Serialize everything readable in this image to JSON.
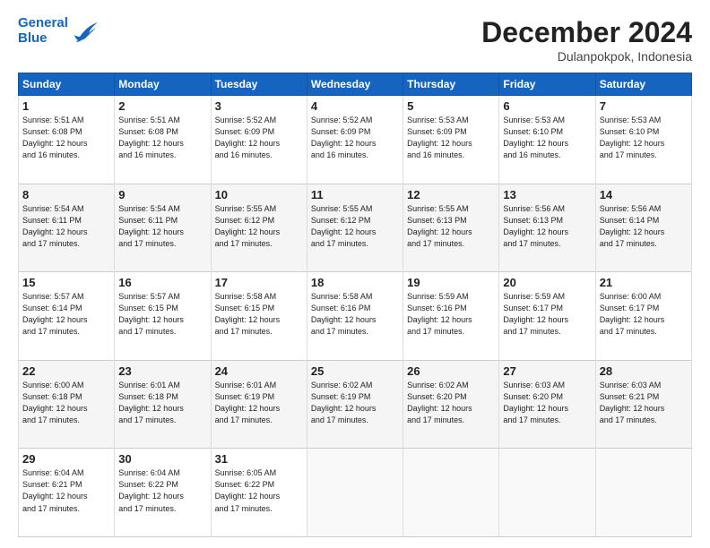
{
  "header": {
    "logo_line1": "General",
    "logo_line2": "Blue",
    "month_title": "December 2024",
    "location": "Dulanpokpok, Indonesia"
  },
  "weekdays": [
    "Sunday",
    "Monday",
    "Tuesday",
    "Wednesday",
    "Thursday",
    "Friday",
    "Saturday"
  ],
  "weeks": [
    [
      {
        "day": "1",
        "info": "Sunrise: 5:51 AM\nSunset: 6:08 PM\nDaylight: 12 hours\nand 16 minutes."
      },
      {
        "day": "2",
        "info": "Sunrise: 5:51 AM\nSunset: 6:08 PM\nDaylight: 12 hours\nand 16 minutes."
      },
      {
        "day": "3",
        "info": "Sunrise: 5:52 AM\nSunset: 6:09 PM\nDaylight: 12 hours\nand 16 minutes."
      },
      {
        "day": "4",
        "info": "Sunrise: 5:52 AM\nSunset: 6:09 PM\nDaylight: 12 hours\nand 16 minutes."
      },
      {
        "day": "5",
        "info": "Sunrise: 5:53 AM\nSunset: 6:09 PM\nDaylight: 12 hours\nand 16 minutes."
      },
      {
        "day": "6",
        "info": "Sunrise: 5:53 AM\nSunset: 6:10 PM\nDaylight: 12 hours\nand 16 minutes."
      },
      {
        "day": "7",
        "info": "Sunrise: 5:53 AM\nSunset: 6:10 PM\nDaylight: 12 hours\nand 17 minutes."
      }
    ],
    [
      {
        "day": "8",
        "info": "Sunrise: 5:54 AM\nSunset: 6:11 PM\nDaylight: 12 hours\nand 17 minutes."
      },
      {
        "day": "9",
        "info": "Sunrise: 5:54 AM\nSunset: 6:11 PM\nDaylight: 12 hours\nand 17 minutes."
      },
      {
        "day": "10",
        "info": "Sunrise: 5:55 AM\nSunset: 6:12 PM\nDaylight: 12 hours\nand 17 minutes."
      },
      {
        "day": "11",
        "info": "Sunrise: 5:55 AM\nSunset: 6:12 PM\nDaylight: 12 hours\nand 17 minutes."
      },
      {
        "day": "12",
        "info": "Sunrise: 5:55 AM\nSunset: 6:13 PM\nDaylight: 12 hours\nand 17 minutes."
      },
      {
        "day": "13",
        "info": "Sunrise: 5:56 AM\nSunset: 6:13 PM\nDaylight: 12 hours\nand 17 minutes."
      },
      {
        "day": "14",
        "info": "Sunrise: 5:56 AM\nSunset: 6:14 PM\nDaylight: 12 hours\nand 17 minutes."
      }
    ],
    [
      {
        "day": "15",
        "info": "Sunrise: 5:57 AM\nSunset: 6:14 PM\nDaylight: 12 hours\nand 17 minutes."
      },
      {
        "day": "16",
        "info": "Sunrise: 5:57 AM\nSunset: 6:15 PM\nDaylight: 12 hours\nand 17 minutes."
      },
      {
        "day": "17",
        "info": "Sunrise: 5:58 AM\nSunset: 6:15 PM\nDaylight: 12 hours\nand 17 minutes."
      },
      {
        "day": "18",
        "info": "Sunrise: 5:58 AM\nSunset: 6:16 PM\nDaylight: 12 hours\nand 17 minutes."
      },
      {
        "day": "19",
        "info": "Sunrise: 5:59 AM\nSunset: 6:16 PM\nDaylight: 12 hours\nand 17 minutes."
      },
      {
        "day": "20",
        "info": "Sunrise: 5:59 AM\nSunset: 6:17 PM\nDaylight: 12 hours\nand 17 minutes."
      },
      {
        "day": "21",
        "info": "Sunrise: 6:00 AM\nSunset: 6:17 PM\nDaylight: 12 hours\nand 17 minutes."
      }
    ],
    [
      {
        "day": "22",
        "info": "Sunrise: 6:00 AM\nSunset: 6:18 PM\nDaylight: 12 hours\nand 17 minutes."
      },
      {
        "day": "23",
        "info": "Sunrise: 6:01 AM\nSunset: 6:18 PM\nDaylight: 12 hours\nand 17 minutes."
      },
      {
        "day": "24",
        "info": "Sunrise: 6:01 AM\nSunset: 6:19 PM\nDaylight: 12 hours\nand 17 minutes."
      },
      {
        "day": "25",
        "info": "Sunrise: 6:02 AM\nSunset: 6:19 PM\nDaylight: 12 hours\nand 17 minutes."
      },
      {
        "day": "26",
        "info": "Sunrise: 6:02 AM\nSunset: 6:20 PM\nDaylight: 12 hours\nand 17 minutes."
      },
      {
        "day": "27",
        "info": "Sunrise: 6:03 AM\nSunset: 6:20 PM\nDaylight: 12 hours\nand 17 minutes."
      },
      {
        "day": "28",
        "info": "Sunrise: 6:03 AM\nSunset: 6:21 PM\nDaylight: 12 hours\nand 17 minutes."
      }
    ],
    [
      {
        "day": "29",
        "info": "Sunrise: 6:04 AM\nSunset: 6:21 PM\nDaylight: 12 hours\nand 17 minutes."
      },
      {
        "day": "30",
        "info": "Sunrise: 6:04 AM\nSunset: 6:22 PM\nDaylight: 12 hours\nand 17 minutes."
      },
      {
        "day": "31",
        "info": "Sunrise: 6:05 AM\nSunset: 6:22 PM\nDaylight: 12 hours\nand 17 minutes."
      },
      {
        "day": "",
        "info": ""
      },
      {
        "day": "",
        "info": ""
      },
      {
        "day": "",
        "info": ""
      },
      {
        "day": "",
        "info": ""
      }
    ]
  ]
}
